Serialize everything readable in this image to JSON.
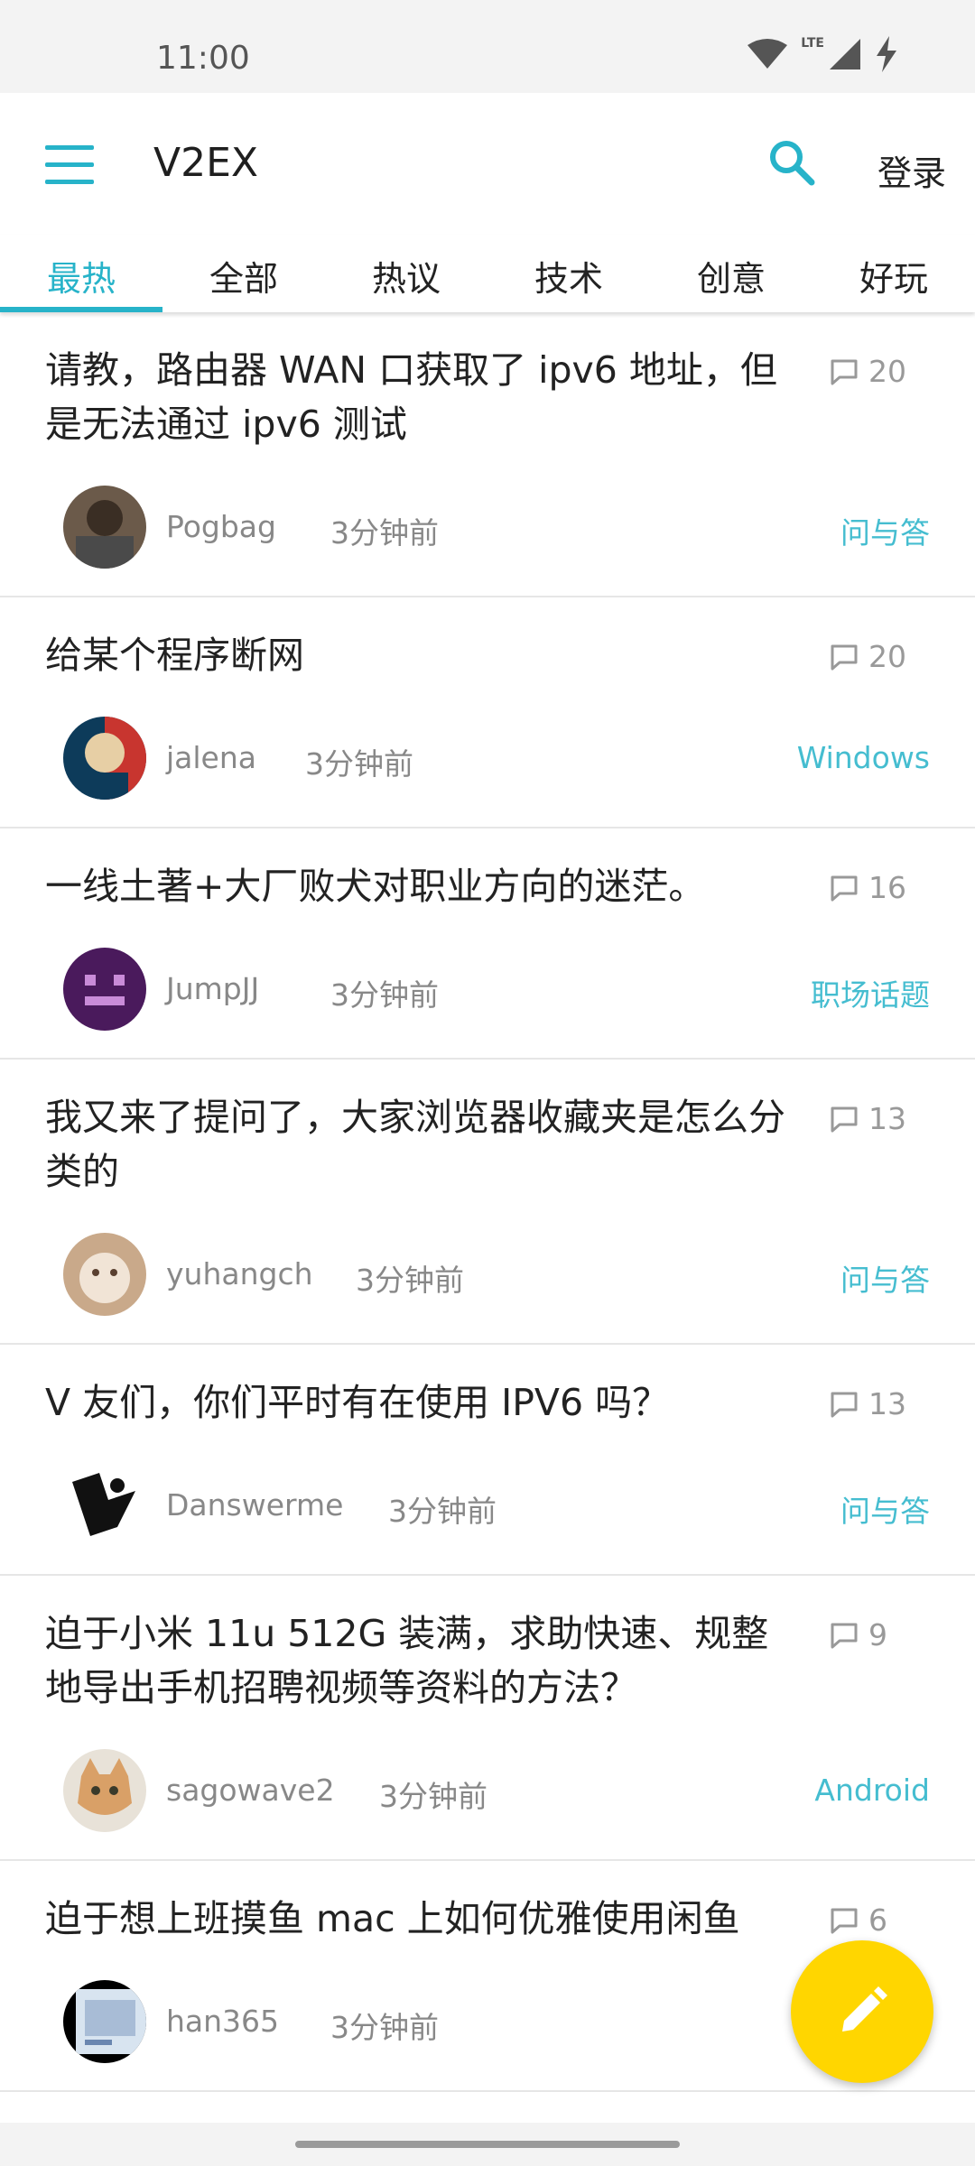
{
  "status": {
    "time": "11:00",
    "network": "LTE"
  },
  "appbar": {
    "title": "V2EX",
    "login_label": "登录"
  },
  "tabs": [
    "最热",
    "全部",
    "热议",
    "技术",
    "创意",
    "好玩"
  ],
  "topics": [
    {
      "title": "请教，路由器 WAN 口获取了 ipv6 地址，但是无法通过 ipv6 测试",
      "comments": "20",
      "username": "Pogbag",
      "time": "3分钟前",
      "node": "问与答"
    },
    {
      "title": "给某个程序断网",
      "comments": "20",
      "username": "jalena",
      "time": "3分钟前",
      "node": "Windows"
    },
    {
      "title": "一线土著+大厂败犬对职业方向的迷茫。",
      "comments": "16",
      "username": "JumpJJ",
      "time": "3分钟前",
      "node": "职场话题"
    },
    {
      "title": "我又来了提问了，大家浏览器收藏夹是怎么分类的",
      "comments": "13",
      "username": "yuhangch",
      "time": "3分钟前",
      "node": "问与答"
    },
    {
      "title": "V 友们，你们平时有在使用 IPV6 吗？",
      "comments": "13",
      "username": "Danswerme",
      "time": "3分钟前",
      "node": "问与答"
    },
    {
      "title": "迫于小米 11u 512G 装满，求助快速、规整地导出手机招聘视频等资料的方法？",
      "comments": "9",
      "username": "sagowave2",
      "time": "3分钟前",
      "node": "Android"
    },
    {
      "title": "迫于想上班摸鱼 mac 上如何优雅使用闲鱼",
      "comments": "6",
      "username": "han365",
      "time": "3分钟前",
      "node": ""
    }
  ],
  "colors": {
    "accent": "#27b3c9",
    "node": "#45bdd0",
    "fab": "#ffd600"
  }
}
